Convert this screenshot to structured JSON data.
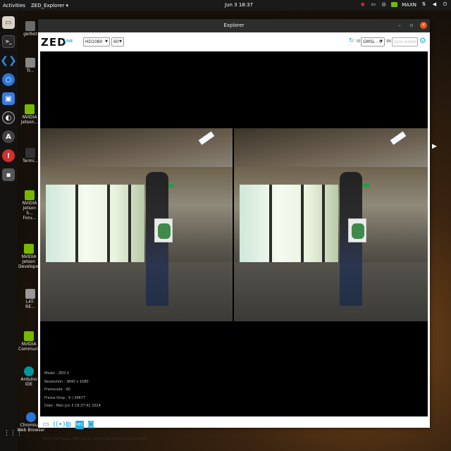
{
  "topbar": {
    "activities": "Activities",
    "app_menu": "ZED_Explorer ▾",
    "clock": "Jun 3  18:37",
    "maxn_label": "MAXN"
  },
  "dock": {
    "apps_glyph": "⋮⋮⋮"
  },
  "desktop": {
    "items": [
      {
        "label": "gerbot"
      },
      {
        "label": "Tr..."
      },
      {
        "label": "NVIDIA Jetson..."
      },
      {
        "label": "Termi..."
      },
      {
        "label": "NVIDIA Jetson S... Foru..."
      },
      {
        "label": "NVIDIA Jetson Develope..."
      },
      {
        "label": "L4T-RE..."
      },
      {
        "label": "NVIDIA Communit..."
      },
      {
        "label": "Arduino IDE"
      },
      {
        "label": "Chromium Web Browser"
      }
    ]
  },
  "window": {
    "title": "Explorer",
    "minimize_glyph": "–",
    "maximize_glyph": "▫",
    "close_glyph": "✕"
  },
  "toolbar": {
    "logo": "ZED",
    "live_label": "LIVE",
    "resolution": "HD1080",
    "fps": "60",
    "id_label": "ID",
    "id_value": "GMSL - 0",
    "sn_label": "SN",
    "sn_placeholder": "SERIAL NUMBER"
  },
  "info": {
    "model": "Model : ZED-X",
    "resolution": "Resolution : 3840 x 1080",
    "framerate": "Framerate : 60",
    "frame_drop": "Frame Drop : 9 / 34677",
    "date": "Date : Mon Jun 3 18:37:41 2024"
  },
  "status_bar": {
    "disk": "Disk Free Space: 860 Gb  on: /home/gerbot/Documents/ZED",
    "version": "v4.0.8"
  },
  "icons": {
    "folder": "folder-icon",
    "stream": "stream-icon",
    "hand": "accessibility-icon",
    "record": "record-icon",
    "snapshot": "camera-icon"
  },
  "colors": {
    "accent": "#2aa8e0",
    "titlebar": "#2d2d2d",
    "close": "#e95420"
  }
}
